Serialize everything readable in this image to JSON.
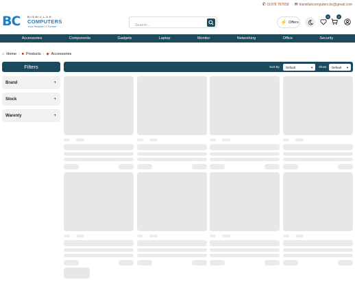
{
  "topbar": {
    "phone": "01976 767658",
    "email": "bismillahcomputers.bc@gmail.com"
  },
  "logo": {
    "mark": "BC",
    "top_text": "BISMILLAH",
    "main_text": "COMPUTERS",
    "tagline": "Your Reliable IT Partner"
  },
  "search": {
    "placeholder": "Search..."
  },
  "header": {
    "offers_label": "Offers",
    "wishlist_count": "0",
    "cart_count": "0"
  },
  "nav": {
    "items": [
      "Accessories",
      "Components",
      "Gadgets",
      "Laptop",
      "Monitor",
      "Networking",
      "Office",
      "Security"
    ]
  },
  "breadcrumb": {
    "home": "Home",
    "products": "Products",
    "current": "Accessories"
  },
  "filters": {
    "title": "Filters",
    "groups": [
      "Brand",
      "Stock",
      "Warenty"
    ]
  },
  "sort": {
    "sort_by_label": "Sort By",
    "sort_by_value": "Default",
    "show_label": "Show",
    "show_value": "Default"
  },
  "colors": {
    "primary": "#1c4a5c",
    "brand_blue": "#1d7fc1",
    "accent_text": "#b5461a",
    "skeleton": "#e6e7e6"
  }
}
